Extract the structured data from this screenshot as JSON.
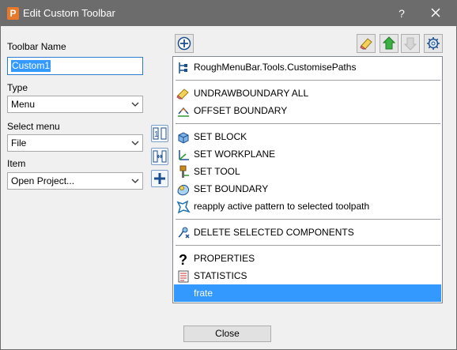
{
  "window": {
    "title": "Edit Custom Toolbar",
    "app_badge": "P",
    "help_label": "?"
  },
  "form": {
    "toolbar_name_label": "Toolbar Name",
    "toolbar_name_value": "Custom1",
    "type_label": "Type",
    "type_value": "Menu",
    "select_menu_label": "Select menu",
    "select_menu_value": "File",
    "item_label": "Item",
    "item_value": "Open Project..."
  },
  "items": [
    {
      "label": "RoughMenuBar.Tools.CustomisePaths",
      "icon": "tree-icon"
    },
    {
      "label": "UNDRAWBOUNDARY ALL",
      "icon": "eraser-icon"
    },
    {
      "label": "OFFSET BOUNDARY",
      "icon": "offset-icon"
    },
    {
      "label": "SET BLOCK",
      "icon": "block-icon"
    },
    {
      "label": "SET WORKPLANE",
      "icon": "workplane-icon"
    },
    {
      "label": "SET TOOL",
      "icon": "tool-icon"
    },
    {
      "label": "SET BOUNDARY",
      "icon": "boundary-icon"
    },
    {
      "label": "reapply active pattern to selected toolpath",
      "icon": "pattern-icon"
    },
    {
      "label": "DELETE SELECTED COMPONENTS",
      "icon": "delete-components-icon"
    },
    {
      "label": "PROPERTIES",
      "icon": "question-icon"
    },
    {
      "label": "STATISTICS",
      "icon": "statistics-icon"
    },
    {
      "label": "frate",
      "icon": "none",
      "selected": true
    }
  ],
  "footer": {
    "close_label": "Close"
  },
  "colors": {
    "titlebar": "#6c6c6c",
    "selection": "#3399ff",
    "accent_green": "#2e9b2e"
  }
}
